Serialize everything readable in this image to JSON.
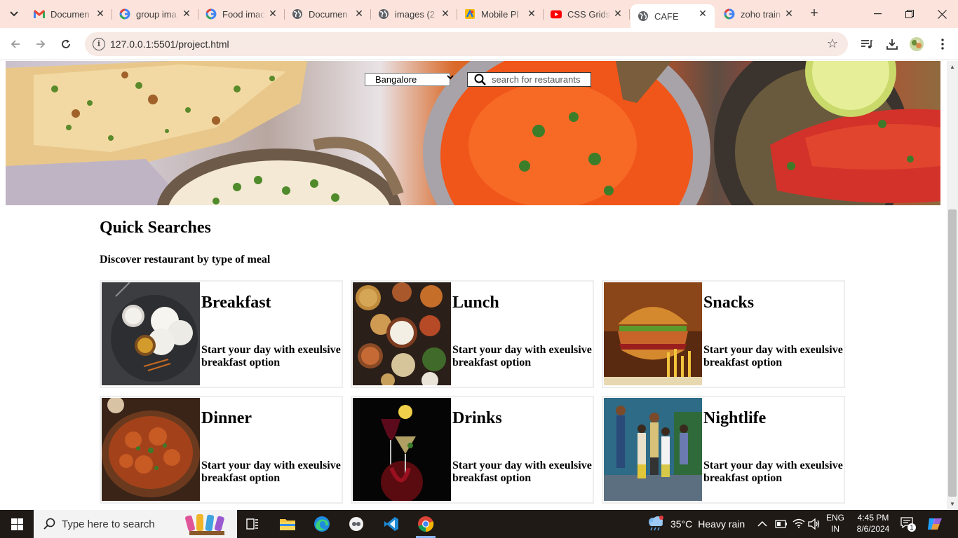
{
  "browser": {
    "tabs": [
      {
        "title": "Documen",
        "icon": "gmail-icon",
        "active": false
      },
      {
        "title": "group ima",
        "icon": "google-icon",
        "active": false
      },
      {
        "title": "Food imac",
        "icon": "google-icon",
        "active": false
      },
      {
        "title": "Documen",
        "icon": "globe-icon",
        "active": false
      },
      {
        "title": "images (2",
        "icon": "globe-icon",
        "active": false
      },
      {
        "title": "Mobile Pl",
        "icon": "figma-icon",
        "active": false
      },
      {
        "title": "CSS Grids",
        "icon": "youtube-icon",
        "active": false
      },
      {
        "title": "CAFE",
        "icon": "globe-icon",
        "active": true
      },
      {
        "title": "zoho train",
        "icon": "google-icon",
        "active": false
      }
    ],
    "url": "127.0.0.1:5501/project.html"
  },
  "page": {
    "city_select": {
      "value": "Bangalore"
    },
    "search": {
      "placeholder": "search for restaurants"
    },
    "quick_searches": {
      "title": "Quick Searches",
      "subtitle": "Discover restaurant by type of meal",
      "cards": [
        {
          "name": "Breakfast",
          "desc": "Start your day with exeulsive breakfast option"
        },
        {
          "name": "Lunch",
          "desc": "Start your day with exeulsive breakfast option"
        },
        {
          "name": "Snacks",
          "desc": "Start your day with exeulsive breakfast option"
        },
        {
          "name": "Dinner",
          "desc": "Start your day with exeulsive breakfast option"
        },
        {
          "name": "Drinks",
          "desc": "Start your day with exeulsive breakfast option"
        },
        {
          "name": "Nightlife",
          "desc": "Start your day with exeulsive breakfast option"
        }
      ]
    }
  },
  "taskbar": {
    "search_placeholder": "Type here to search",
    "weather": {
      "temp": "35°C",
      "condition": "Heavy rain"
    },
    "language": {
      "line1": "ENG",
      "line2": "IN"
    },
    "clock": {
      "time": "4:45 PM",
      "date": "8/6/2024"
    },
    "notification_count": "1"
  },
  "colors": {
    "tabstrip": "#fce4dc",
    "omnibox": "#f7e9e4",
    "taskbar": "#1f1a16",
    "accent": "#8ab4f8"
  }
}
